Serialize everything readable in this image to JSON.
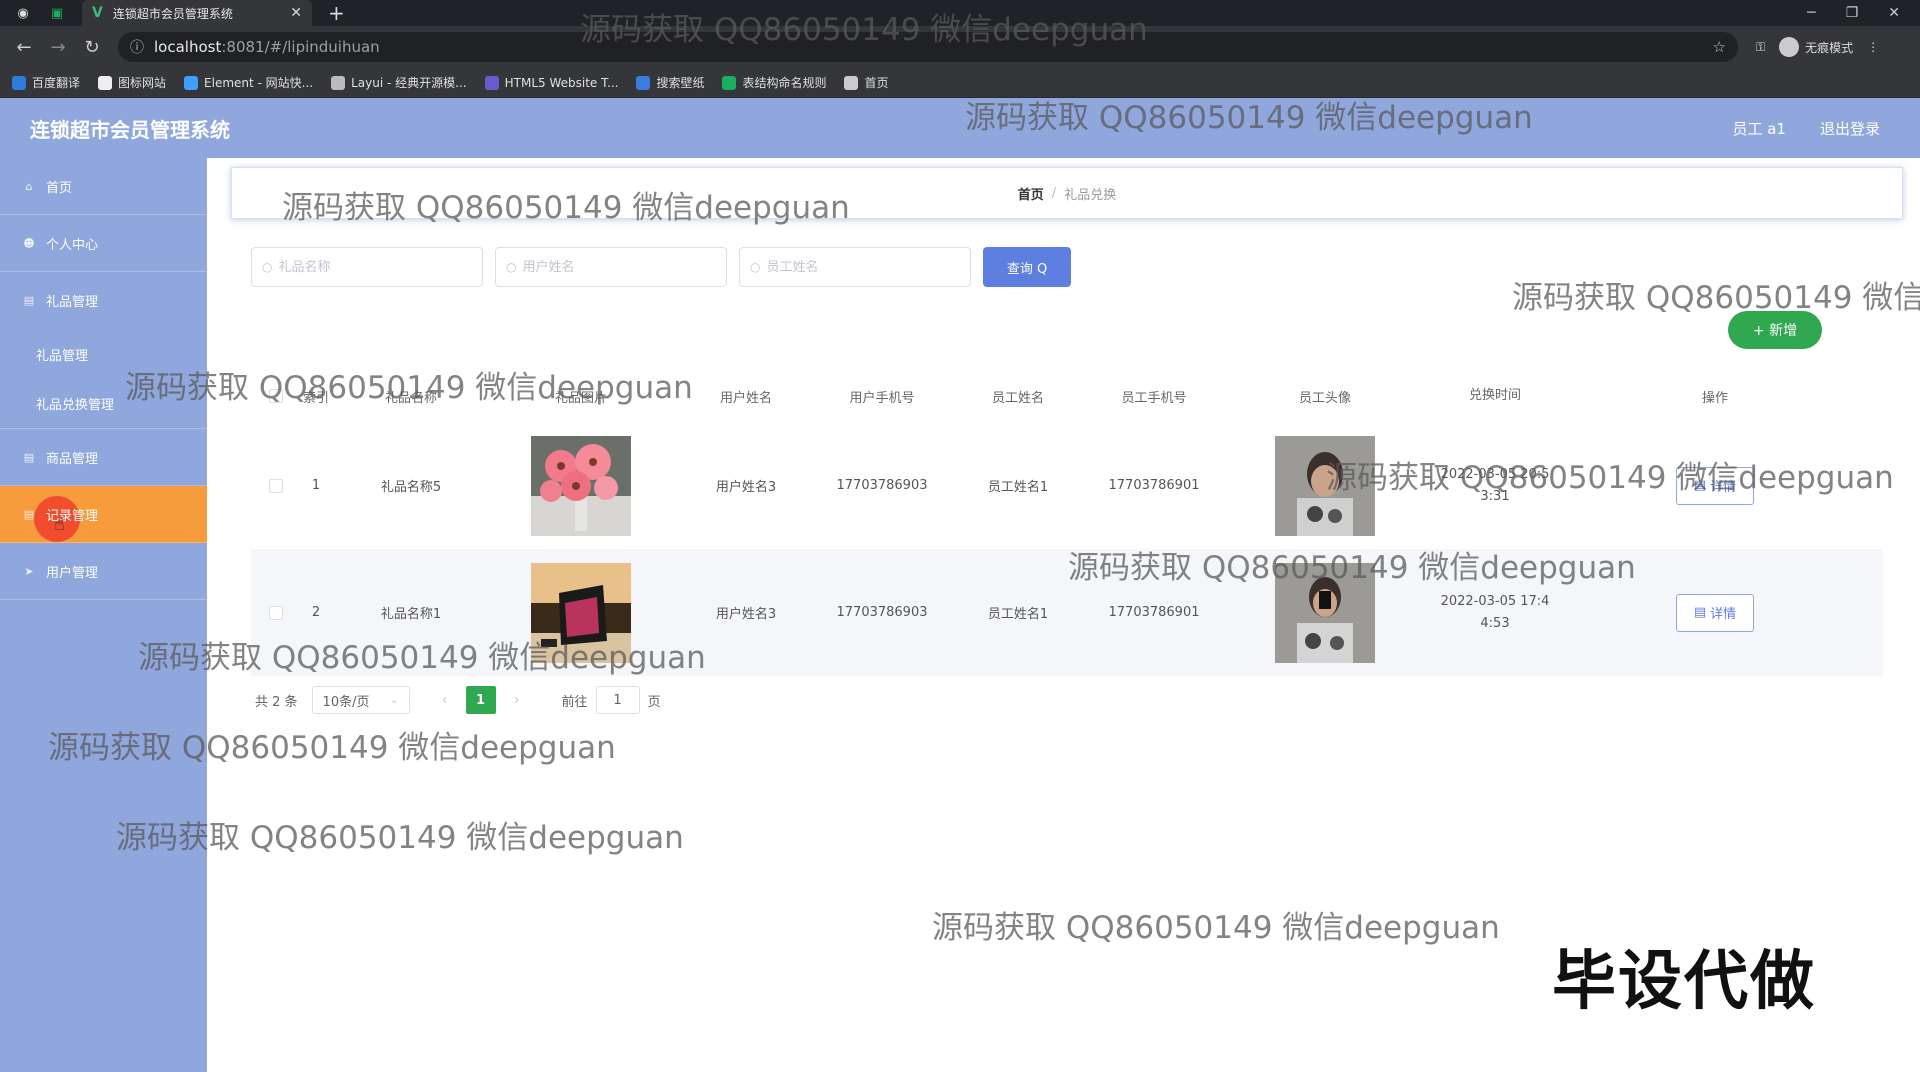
{
  "browser": {
    "tab_title": "连锁超市会员管理系统",
    "url_host": "localhost",
    "url_rest": ":8081/#/lipinduihuan",
    "incognito_label": "无痕模式",
    "bookmarks": [
      {
        "label": "百度翻译",
        "color": "#2f7bd8"
      },
      {
        "label": "图标网站",
        "color": "#eeeeee"
      },
      {
        "label": "Element - 网站快...",
        "color": "#409eff"
      },
      {
        "label": "Layui - 经典开源模...",
        "color": "#bbbbbb"
      },
      {
        "label": "HTML5 Website T...",
        "color": "#6a5acd"
      },
      {
        "label": "搜索壁纸",
        "color": "#3b7ddd"
      },
      {
        "label": "表结构命名规则",
        "color": "#1aaf5d"
      },
      {
        "label": "首页",
        "color": "#cccccc"
      }
    ]
  },
  "header": {
    "title": "连锁超市会员管理系统",
    "user_label": "员工 a1",
    "logout_label": "退出登录",
    "bg_color": "#8fa7dd"
  },
  "sidebar": {
    "items": [
      {
        "label": "首页",
        "icon": "home-icon"
      },
      {
        "label": "个人中心",
        "icon": "user-icon"
      },
      {
        "label": "礼品管理",
        "icon": "box-icon"
      },
      {
        "label": "礼品管理",
        "submenu": true
      },
      {
        "label": "礼品兑换管理",
        "submenu": true
      },
      {
        "label": "商品管理",
        "icon": "box-icon"
      },
      {
        "label": "记录管理",
        "icon": "record-icon",
        "active": true
      },
      {
        "label": "用户管理",
        "icon": "send-icon"
      }
    ],
    "active_color": "#f79c3c"
  },
  "breadcrumb": {
    "home": "首页",
    "separator": "/",
    "current": "礼品兑换"
  },
  "search": {
    "gift_name_placeholder": "礼品名称",
    "user_name_placeholder": "用户姓名",
    "employee_name_placeholder": "员工姓名",
    "query_label": "查询 Q"
  },
  "add_label": "+ 新增",
  "table": {
    "columns": [
      "索引",
      "礼品名称",
      "礼品图片",
      "用户姓名",
      "用户手机号",
      "员工姓名",
      "员工手机号",
      "员工头像",
      "兑换时间",
      "操作"
    ],
    "rows": [
      {
        "index": "1",
        "gift_name": "礼品名称5",
        "user_name": "用户姓名3",
        "user_phone": "17703786903",
        "employee_name": "员工姓名1",
        "employee_phone": "17703786901",
        "time_line1": "2022-03-05 20:5",
        "time_line2": "3:31",
        "action": "详情"
      },
      {
        "index": "2",
        "gift_name": "礼品名称1",
        "user_name": "用户姓名3",
        "user_phone": "17703786903",
        "employee_name": "员工姓名1",
        "employee_phone": "17703786901",
        "time_line1": "2022-03-05 17:4",
        "time_line2": "4:53",
        "action": "详情"
      }
    ]
  },
  "pagination": {
    "total": "共 2 条",
    "page_size": "10条/页",
    "current_page": "1",
    "goto_label": "前往",
    "goto_value": "1",
    "page_unit": "页",
    "active_color": "#2fa84f"
  },
  "watermark_text": "源码获取 QQ86050149 微信deepguan",
  "corner_text": "毕设代做"
}
